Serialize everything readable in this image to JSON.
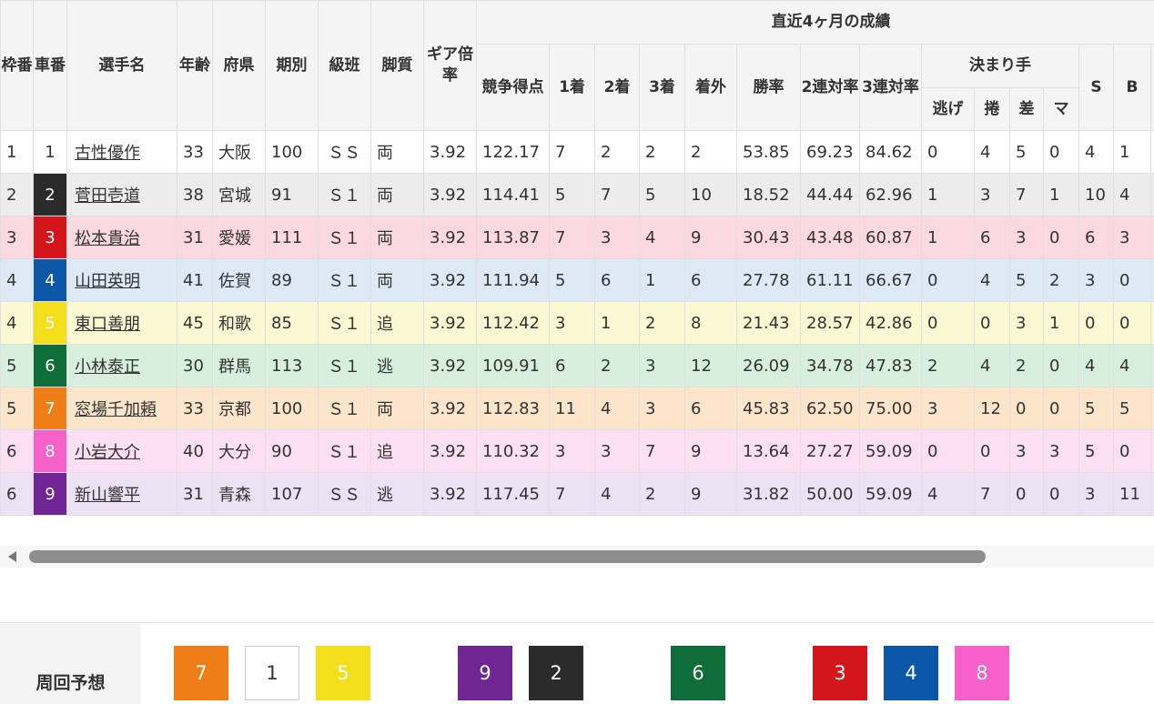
{
  "headers": {
    "waku": "枠番",
    "car": "車番",
    "name": "選手名",
    "age": "年齢",
    "pref": "府県",
    "term": "期別",
    "grade": "級班",
    "style": "脚質",
    "gear": "ギア倍率",
    "score": "競争得点",
    "recent_group": "直近4ヶ月の成績",
    "first": "1着",
    "second": "2着",
    "third": "3着",
    "out": "着外",
    "win_rate": "勝率",
    "top2_rate": "2連対率",
    "top3_rate": "3連対率",
    "kimarite": "決まり手",
    "nige": "逃げ",
    "makuri": "捲",
    "sashi": "差",
    "mark": "マ",
    "s": "S",
    "b": "B"
  },
  "car_colors": {
    "1": {
      "bg": "#ffffff",
      "fg": "#333333"
    },
    "2": {
      "bg": "#2b2b2b",
      "fg": "#ffffff"
    },
    "3": {
      "bg": "#d4161c",
      "fg": "#ffffff"
    },
    "4": {
      "bg": "#0d57a8",
      "fg": "#ffffff"
    },
    "5": {
      "bg": "#f4df1d",
      "fg": "#ffffff"
    },
    "6": {
      "bg": "#0e6d38",
      "fg": "#ffffff"
    },
    "7": {
      "bg": "#ef7d18",
      "fg": "#ffffff"
    },
    "8": {
      "bg": "#f660c8",
      "fg": "#ffffff"
    },
    "9": {
      "bg": "#6f2694",
      "fg": "#ffffff"
    }
  },
  "rows": [
    {
      "waku": "1",
      "car": "1",
      "name": "古性優作",
      "age": "33",
      "pref": "大阪",
      "term": "100",
      "grade": "ＳＳ",
      "style": "両",
      "gear": "3.92",
      "score": "122.17",
      "first": "7",
      "second": "2",
      "third": "2",
      "out": "2",
      "win_rate": "53.85",
      "top2_rate": "69.23",
      "top3_rate": "84.62",
      "nige": "0",
      "makuri": "4",
      "sashi": "5",
      "mark": "0",
      "s": "4",
      "b": "1",
      "row_bg": "#ffffff"
    },
    {
      "waku": "2",
      "car": "2",
      "name": "菅田壱道",
      "age": "38",
      "pref": "宮城",
      "term": "91",
      "grade": "Ｓ１",
      "style": "両",
      "gear": "3.92",
      "score": "114.41",
      "first": "5",
      "second": "7",
      "third": "5",
      "out": "10",
      "win_rate": "18.52",
      "top2_rate": "44.44",
      "top3_rate": "62.96",
      "nige": "1",
      "makuri": "3",
      "sashi": "7",
      "mark": "1",
      "s": "10",
      "b": "4",
      "row_bg": "#ececec"
    },
    {
      "waku": "3",
      "car": "3",
      "name": "松本貴治",
      "age": "31",
      "pref": "愛媛",
      "term": "111",
      "grade": "Ｓ１",
      "style": "両",
      "gear": "3.92",
      "score": "113.87",
      "first": "7",
      "second": "3",
      "third": "4",
      "out": "9",
      "win_rate": "30.43",
      "top2_rate": "43.48",
      "top3_rate": "60.87",
      "nige": "1",
      "makuri": "6",
      "sashi": "3",
      "mark": "0",
      "s": "6",
      "b": "3",
      "row_bg": "#fcd9e0"
    },
    {
      "waku": "4",
      "car": "4",
      "name": "山田英明",
      "age": "41",
      "pref": "佐賀",
      "term": "89",
      "grade": "Ｓ１",
      "style": "両",
      "gear": "3.92",
      "score": "111.94",
      "first": "5",
      "second": "6",
      "third": "1",
      "out": "6",
      "win_rate": "27.78",
      "top2_rate": "61.11",
      "top3_rate": "66.67",
      "nige": "0",
      "makuri": "4",
      "sashi": "5",
      "mark": "2",
      "s": "3",
      "b": "0",
      "row_bg": "#dde9f5"
    },
    {
      "waku": "4",
      "car": "5",
      "name": "東口善朋",
      "age": "45",
      "pref": "和歌",
      "term": "85",
      "grade": "Ｓ１",
      "style": "追",
      "gear": "3.92",
      "score": "112.42",
      "first": "3",
      "second": "1",
      "third": "2",
      "out": "8",
      "win_rate": "21.43",
      "top2_rate": "28.57",
      "top3_rate": "42.86",
      "nige": "0",
      "makuri": "0",
      "sashi": "3",
      "mark": "1",
      "s": "0",
      "b": "0",
      "row_bg": "#fdf8d4"
    },
    {
      "waku": "5",
      "car": "6",
      "name": "小林泰正",
      "age": "30",
      "pref": "群馬",
      "term": "113",
      "grade": "Ｓ１",
      "style": "逃",
      "gear": "3.92",
      "score": "109.91",
      "first": "6",
      "second": "2",
      "third": "3",
      "out": "12",
      "win_rate": "26.09",
      "top2_rate": "34.78",
      "top3_rate": "47.83",
      "nige": "2",
      "makuri": "4",
      "sashi": "2",
      "mark": "0",
      "s": "4",
      "b": "4",
      "row_bg": "#d9efdd"
    },
    {
      "waku": "5",
      "car": "7",
      "name": "窓場千加頼",
      "age": "33",
      "pref": "京都",
      "term": "100",
      "grade": "Ｓ１",
      "style": "両",
      "gear": "3.92",
      "score": "112.83",
      "first": "11",
      "second": "4",
      "third": "3",
      "out": "6",
      "win_rate": "45.83",
      "top2_rate": "62.50",
      "top3_rate": "75.00",
      "nige": "3",
      "makuri": "12",
      "sashi": "0",
      "mark": "0",
      "s": "5",
      "b": "5",
      "row_bg": "#fde5cc"
    },
    {
      "waku": "6",
      "car": "8",
      "name": "小岩大介",
      "age": "40",
      "pref": "大分",
      "term": "90",
      "grade": "Ｓ１",
      "style": "追",
      "gear": "3.92",
      "score": "110.32",
      "first": "3",
      "second": "3",
      "third": "7",
      "out": "9",
      "win_rate": "13.64",
      "top2_rate": "27.27",
      "top3_rate": "59.09",
      "nige": "0",
      "makuri": "0",
      "sashi": "3",
      "mark": "3",
      "s": "5",
      "b": "0",
      "row_bg": "#fcdff2"
    },
    {
      "waku": "6",
      "car": "9",
      "name": "新山響平",
      "age": "31",
      "pref": "青森",
      "term": "107",
      "grade": "ＳＳ",
      "style": "逃",
      "gear": "3.92",
      "score": "117.45",
      "first": "7",
      "second": "4",
      "third": "2",
      "out": "9",
      "win_rate": "31.82",
      "top2_rate": "50.00",
      "top3_rate": "59.09",
      "nige": "4",
      "makuri": "7",
      "sashi": "0",
      "mark": "0",
      "s": "3",
      "b": "11",
      "row_bg": "#ece2f3"
    }
  ],
  "forecast": {
    "label": "周回予想",
    "order": [
      "7",
      "1",
      "5",
      "",
      "9",
      "2",
      "",
      "6",
      "",
      "3",
      "4",
      "8"
    ]
  }
}
